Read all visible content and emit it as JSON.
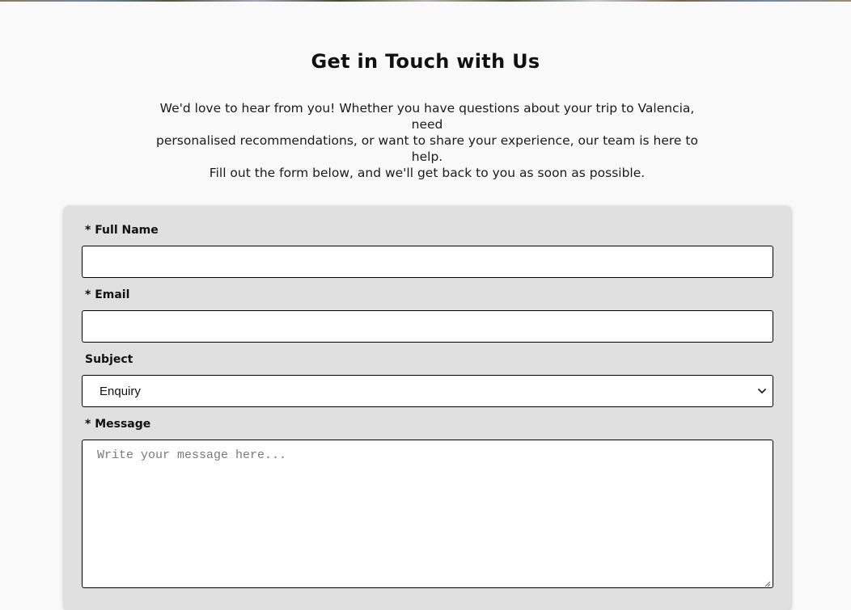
{
  "page": {
    "heading": "Get in Touch with Us",
    "intro_line_1": "We'd love to hear from you! Whether you have questions about your trip to Valencia, need",
    "intro_line_2": "personalised recommendations, or want to share your experience, our team is here to help.",
    "intro_line_3": "Fill out the form below, and we'll get back to you as soon as possible."
  },
  "form": {
    "full_name": {
      "label": "* Full Name",
      "value": "",
      "placeholder": ""
    },
    "email": {
      "label": "* Email",
      "value": "",
      "placeholder": ""
    },
    "subject": {
      "label": "Subject",
      "selected": "Enquiry"
    },
    "message": {
      "label": "* Message",
      "placeholder": "Write your message here..."
    }
  }
}
